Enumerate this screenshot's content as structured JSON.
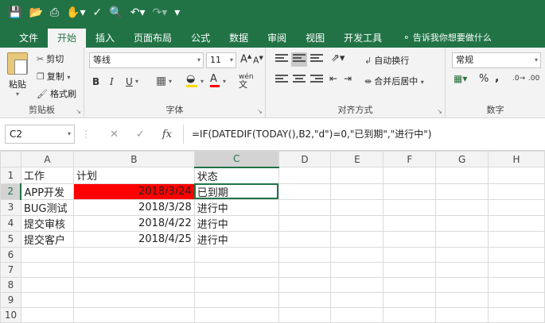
{
  "qat": {
    "icons": [
      "save-icon",
      "open-icon",
      "print-icon",
      "touch-mode-icon",
      "spell-check-icon",
      "print-preview-icon",
      "undo-icon",
      "redo-icon",
      "customize-icon"
    ]
  },
  "tabs": [
    "文件",
    "开始",
    "插入",
    "页面布局",
    "公式",
    "数据",
    "审阅",
    "视图",
    "开发工具"
  ],
  "active_tab": "开始",
  "tell_me": "告诉我你想要做什么",
  "ribbon": {
    "clipboard": {
      "paste": "粘贴",
      "cut": "剪切",
      "copy": "复制",
      "format_painter": "格式刷",
      "label": "剪贴板"
    },
    "font": {
      "name": "等线",
      "size": "11",
      "label": "字体",
      "grow": "A",
      "shrink": "A",
      "bold": "B",
      "italic": "I",
      "underline": "U",
      "font_color": "A",
      "phonetic": "wén"
    },
    "alignment": {
      "wrap": "自动换行",
      "merge": "合并后居中",
      "label": "对齐方式"
    },
    "number": {
      "format": "常规",
      "percent": "%",
      "comma": ",",
      "label": "数字"
    }
  },
  "formula_bar": {
    "name_box": "C2",
    "formula": "=IF(DATEDIF(TODAY(),B2,\"d\")=0,\"已到期\",\"进行中\")"
  },
  "sheet": {
    "columns": [
      "A",
      "B",
      "C",
      "D",
      "E",
      "F",
      "G",
      "H"
    ],
    "rows": [
      {
        "n": "1",
        "cells": [
          "工作",
          "计划",
          "状态"
        ]
      },
      {
        "n": "2",
        "cells": [
          "APP开发",
          "2018/3/24",
          "已到期"
        ]
      },
      {
        "n": "3",
        "cells": [
          "BUG测试",
          "2018/3/28",
          "进行中"
        ]
      },
      {
        "n": "4",
        "cells": [
          "提交审核",
          "2018/4/22",
          "进行中"
        ]
      },
      {
        "n": "5",
        "cells": [
          "提交客户",
          "2018/4/25",
          "进行中"
        ]
      },
      {
        "n": "6",
        "cells": [
          "",
          "",
          ""
        ]
      },
      {
        "n": "7",
        "cells": [
          "",
          "",
          ""
        ]
      },
      {
        "n": "8",
        "cells": [
          "",
          "",
          ""
        ]
      },
      {
        "n": "9",
        "cells": [
          "",
          "",
          ""
        ]
      },
      {
        "n": "10",
        "cells": [
          "",
          "",
          ""
        ]
      }
    ],
    "highlight_color": "#ff0000",
    "accent_color": "#217346"
  }
}
